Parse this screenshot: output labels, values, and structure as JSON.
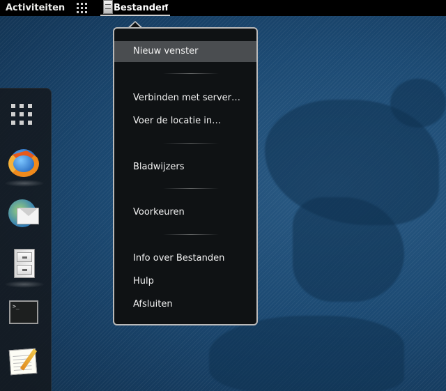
{
  "topbar": {
    "activities_label": "Activiteiten",
    "app_menu_label": "Bestanden",
    "app_menu_arrow": "▾"
  },
  "dash": {
    "items": [
      {
        "name": "show-apps",
        "icon": "apps-grid-icon"
      },
      {
        "name": "firefox",
        "icon": "firefox-icon"
      },
      {
        "name": "mail",
        "icon": "mail-icon"
      },
      {
        "name": "files",
        "icon": "file-cabinet-icon"
      },
      {
        "name": "terminal",
        "icon": "terminal-icon"
      },
      {
        "name": "text-editor",
        "icon": "text-editor-icon"
      }
    ],
    "terminal_prompt": ">_"
  },
  "app_menu": {
    "items": [
      {
        "label": "Nieuw venster",
        "active": true
      },
      {
        "label": "Verbinden met server…"
      },
      {
        "label": "Voer de locatie in…"
      },
      {
        "label": "Bladwijzers"
      },
      {
        "label": "Voorkeuren"
      },
      {
        "label": "Info over Bestanden"
      },
      {
        "label": "Hulp"
      },
      {
        "label": "Afsluiten"
      }
    ]
  },
  "colors": {
    "topbar_bg": "#000000",
    "menu_bg": "#0f1214",
    "menu_highlight": "#4a4d50",
    "desktop_blue": "#1c4a73"
  }
}
